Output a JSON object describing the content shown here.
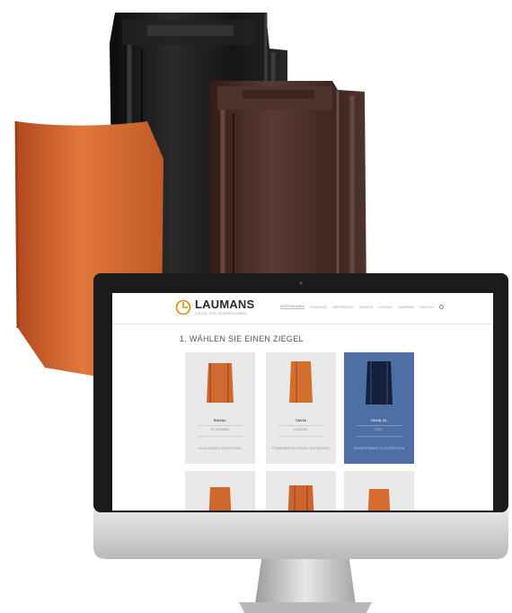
{
  "website": {
    "logo": {
      "name": "LAUMANS",
      "tagline": "ZIEGEL FÜR GENERATIONEN"
    },
    "nav": [
      "UNTERNEHMEN",
      "PRODUKTE",
      "REFERENZEN",
      "SERVICE",
      "KONTAKT",
      "KARRIERE",
      "ENGLISH"
    ],
    "heading": "1. WÄHLEN SIE EINEN ZIEGEL",
    "tiles": [
      {
        "name": "RAVAL",
        "subtitle": "KLASSIKER",
        "cta": "FLACHZIEGEL ENTDECKEN",
        "selected": false
      },
      {
        "name": "TAVIA",
        "subtitle": "KLASSIK",
        "cta": "FORMENREICH ZIEGEL ENTDECKEN",
        "selected": false
      },
      {
        "name": "TAVIA XL",
        "subtitle": "EDEL",
        "cta": "GROSSFORMAT XL ENTDECKEN",
        "selected": true
      }
    ]
  },
  "colors": {
    "orange_tile": "#d0652c",
    "black_tile": "#1c1c1c",
    "brown_tile": "#4a302a",
    "selected_card": "#4d6fa3",
    "monitor_bezel": "#1b1b1b",
    "monitor_silver": "#cfcfcf"
  }
}
